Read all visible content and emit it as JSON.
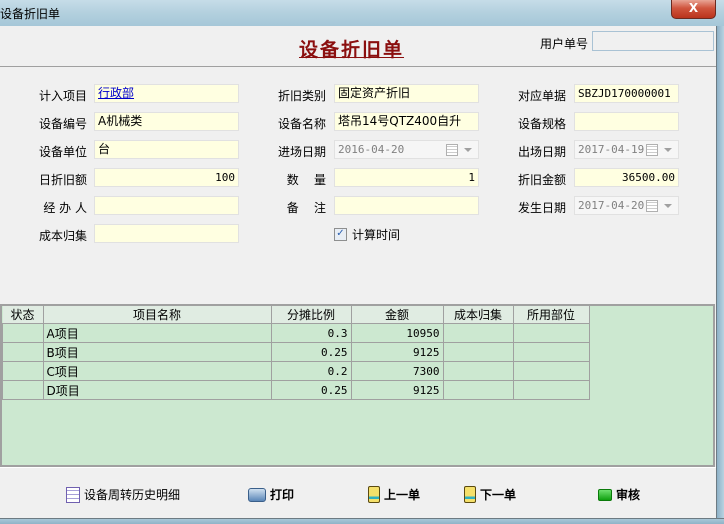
{
  "window": {
    "title": "设备折旧单",
    "close_label": "X"
  },
  "header": {
    "doc_title": "设备折旧单",
    "user_no_label": "用户单号",
    "user_no_value": ""
  },
  "form": {
    "col1": [
      {
        "label": "计入项目",
        "value": "行政部"
      },
      {
        "label": "设备编号",
        "value": "A机械类"
      },
      {
        "label": "设备单位",
        "value": "台"
      },
      {
        "label": "日折旧额",
        "value": "100"
      },
      {
        "label": "经 办 人",
        "value": ""
      },
      {
        "label": "成本归集",
        "value": ""
      }
    ],
    "col2": [
      {
        "label": "折旧类别",
        "value": "固定资产折旧"
      },
      {
        "label": "设备名称",
        "value": "塔吊14号QTZ400自升"
      },
      {
        "label": "进场日期",
        "value": "2016-04-20"
      },
      {
        "label": "数    量",
        "value": "1"
      },
      {
        "label": "备    注",
        "value": ""
      }
    ],
    "col3": [
      {
        "label": "对应单据",
        "value": "SBZJD170000001"
      },
      {
        "label": "设备规格",
        "value": ""
      },
      {
        "label": "出场日期",
        "value": "2017-04-19"
      },
      {
        "label": "折旧金额",
        "value": "36500.00"
      },
      {
        "label": "发生日期",
        "value": "2017-04-20"
      }
    ],
    "calc_time": {
      "label": "计算时间",
      "checked": true
    }
  },
  "grid": {
    "columns": [
      "状态",
      "项目名称",
      "分摊比例",
      "金额",
      "成本归集",
      "所用部位"
    ],
    "rows": [
      {
        "status": "",
        "name": "A项目",
        "ratio": "0.3",
        "amount": "10950",
        "cost": "",
        "part": ""
      },
      {
        "status": "",
        "name": "B项目",
        "ratio": "0.25",
        "amount": "9125",
        "cost": "",
        "part": ""
      },
      {
        "status": "",
        "name": "C项目",
        "ratio": "0.2",
        "amount": "7300",
        "cost": "",
        "part": ""
      },
      {
        "status": "",
        "name": "D项目",
        "ratio": "0.25",
        "amount": "9125",
        "cost": "",
        "part": ""
      }
    ]
  },
  "footer": {
    "history": "设备周转历史明细",
    "print": "打印",
    "prev": "上一单",
    "next": "下一单",
    "audit": "审核"
  }
}
